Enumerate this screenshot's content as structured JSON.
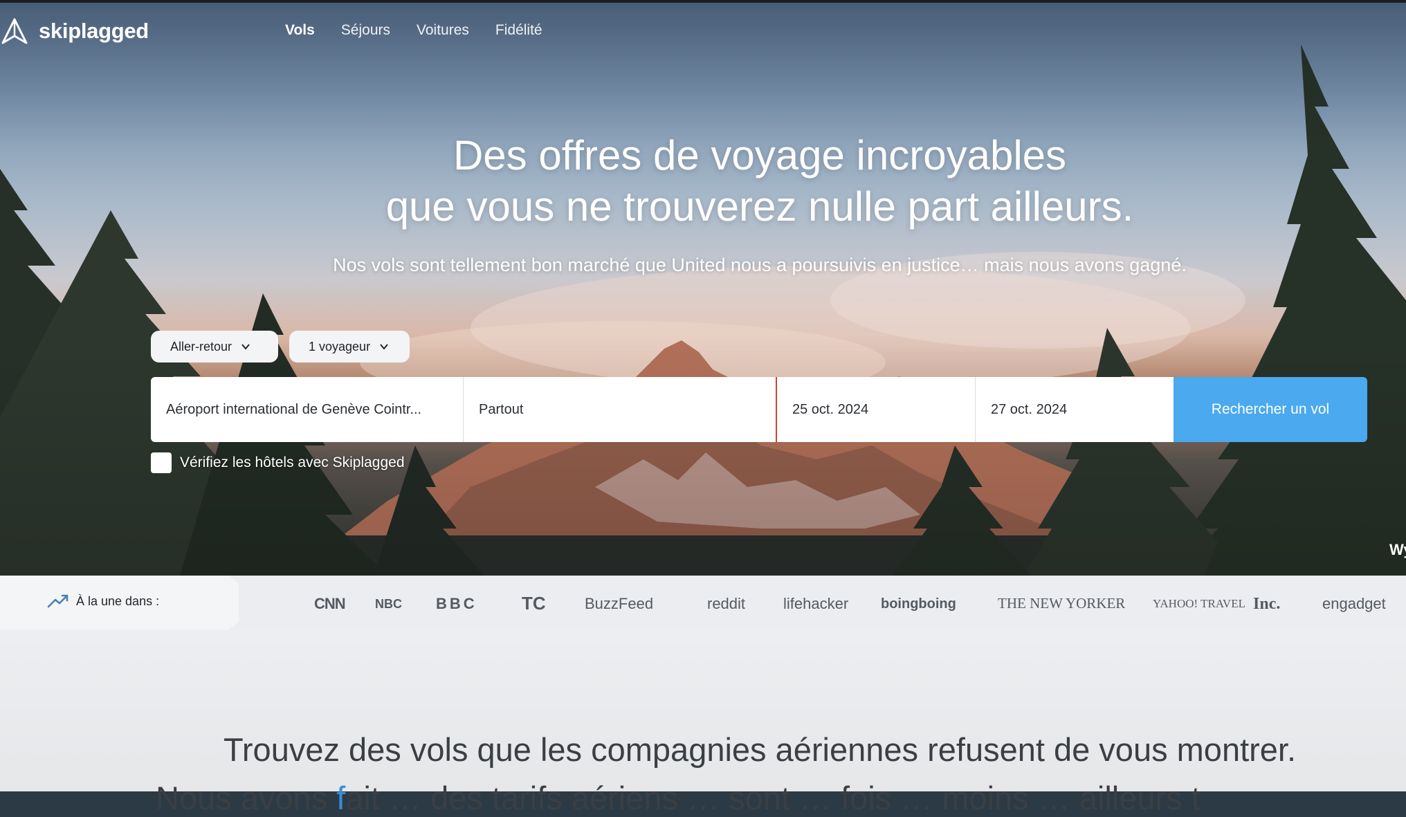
{
  "brand": {
    "name": "skiplagged"
  },
  "nav": {
    "items": [
      "Vols",
      "Séjours",
      "Voitures",
      "Fidélité"
    ],
    "active": "Vols"
  },
  "hero": {
    "title_line1": "Des offres de voyage incroyables",
    "title_line2": "que vous ne trouverez nulle part ailleurs.",
    "subtitle": "Nos vols sont tellement bon marché que United nous a poursuivis en justice… mais nous avons gagné."
  },
  "search": {
    "trip_type": "Aller-retour",
    "travelers": "1 voyageur",
    "origin": "Aéroport international de Genève Cointr...",
    "destination": "Partout",
    "depart_date": "25 oct. 2024",
    "return_date": "27 oct. 2024",
    "submit_label": "Rechercher un vol",
    "hotel_checkbox_label": "Vérifiez les hôtels avec Skiplagged",
    "hotel_checked": false,
    "accent_color": "#4aa9ef"
  },
  "edge_text": "Wy",
  "press": {
    "label": "À la une dans :",
    "brands": [
      "CNN",
      "NBC",
      "BBC",
      "TC",
      "BuzzFeed",
      "reddit",
      "lifehacker",
      "boingboing",
      "THE NEW YORKER",
      "YAHOO! TRAVEL",
      "Inc.",
      "engadget"
    ]
  },
  "bottom": {
    "headline": "Trouvez des vols que les compagnies aériennes refusent de vous montrer.",
    "partial_line_start": "Nous avons",
    "partial_line_highlight": "f",
    "partial_line_rest": "ait … des tarifs aériens … sont … fois … moins … ailleurs t"
  }
}
